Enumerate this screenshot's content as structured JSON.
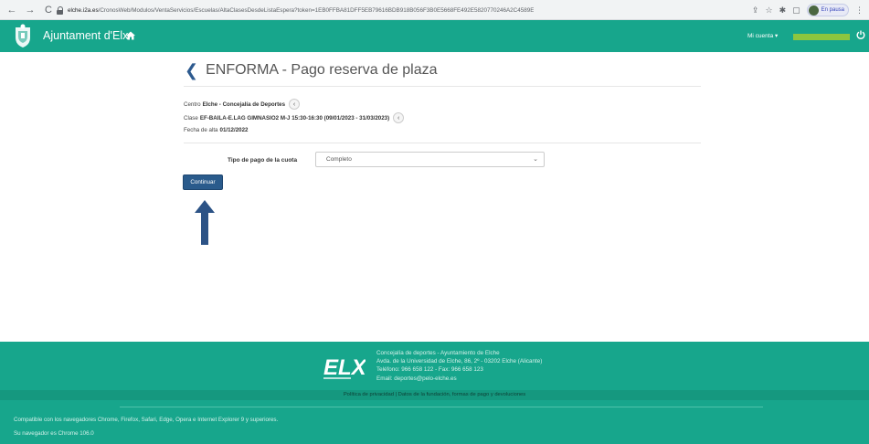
{
  "browser": {
    "url_domain": "elche.i2a.es",
    "url_path": "/CronosWeb/Modulos/VentaServicios/Escuelas/AltaClasesDesdeListaEspera?token=1EB0FFBA81DFF5EB79616BDB918B056F3B0E5668FE492E5820770246A2C4589E",
    "profile_label": "En pausa"
  },
  "header": {
    "app_title": "Ajuntament d'Elx",
    "account_label": "Mi cuenta ▾",
    "user_bar_color": "#8dc63f",
    "brand_color": "#17a68c"
  },
  "page": {
    "title": "ENFORMA - Pago reserva de plaza",
    "centro_label": "Centro",
    "centro_value": "Elche - Concejalía de Deportes",
    "clase_label": "Clase",
    "clase_value": "EF-BAILA-E.LAG GIMNASIO2 M-J 15:30-16:30 (09/01/2023 - 31/03/2023)",
    "fecha_label": "Fecha de alta",
    "fecha_value": "01/12/2022"
  },
  "form": {
    "tipo_pago_label": "Tipo de pago de la cuota",
    "tipo_pago_value": "Completo",
    "continue_label": "Continuar"
  },
  "footer": {
    "info_line1": "Concejalía de deportes - Ayuntamiento de Elche",
    "info_line2": "Avda. de la Universidad de Elche, 86, 2º - 03202 Elche (Alicante)",
    "info_line3": "Teléfono: 966 658 122 - Fax: 966 658 123",
    "info_line4": "Email: deportes@pelo-elche.es",
    "links": "Política de privacidad  |  Datos de la fundación, formas de pago y devoluciones",
    "compat": "Compatible con los navegadores Chrome, Firefox, Safari, Edge, Opera e Internet Explorer 9 y superiores.",
    "browser_info": "Su navegador es Chrome 106.0"
  }
}
